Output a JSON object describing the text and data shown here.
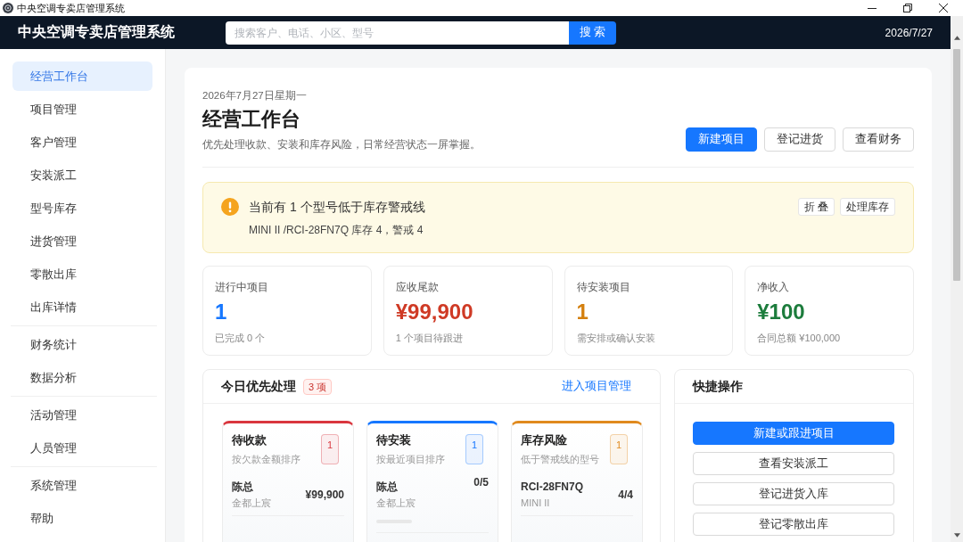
{
  "window": {
    "title": "中央空调专卖店管理系统"
  },
  "header": {
    "title": "中央空调专卖店管理系统",
    "search": {
      "placeholder": "搜索客户、电话、小区、型号",
      "button": "搜 索"
    },
    "date": "2026/7/27"
  },
  "sidebar": {
    "groups": [
      {
        "items": [
          {
            "label": "经营工作台",
            "selected": true
          },
          {
            "label": "项目管理",
            "selected": false
          },
          {
            "label": "客户管理",
            "selected": false
          },
          {
            "label": "安装派工",
            "selected": false
          },
          {
            "label": "型号库存",
            "selected": false
          },
          {
            "label": "进货管理",
            "selected": false
          },
          {
            "label": "零散出库",
            "selected": false
          },
          {
            "label": "出库详情",
            "selected": false
          }
        ]
      },
      {
        "items": [
          {
            "label": "财务统计",
            "selected": false
          },
          {
            "label": "数据分析",
            "selected": false
          }
        ]
      },
      {
        "items": [
          {
            "label": "活动管理",
            "selected": false
          },
          {
            "label": "人员管理",
            "selected": false
          }
        ]
      },
      {
        "items": [
          {
            "label": "系统管理",
            "selected": false
          },
          {
            "label": "帮助",
            "selected": false
          }
        ]
      }
    ]
  },
  "page": {
    "date": "2026年7月27日星期一",
    "title": "经营工作台",
    "subtitle": "优先处理收款、安装和库存风险，日常经营状态一屏掌握。",
    "actions": [
      {
        "label": "新建项目",
        "kind": "primary"
      },
      {
        "label": "登记进货",
        "kind": "default"
      },
      {
        "label": "查看财务",
        "kind": "default"
      }
    ]
  },
  "alert": {
    "title": "当前有 1 个型号低于库存警戒线",
    "detail": "MINI II /RCI-28FN7Q 库存 4，警戒 4",
    "actions": [
      "折 叠",
      "处理库存"
    ]
  },
  "stats": [
    {
      "label": "进行中项目",
      "value": "1",
      "note": "已完成 0 个",
      "color": "#1677ff"
    },
    {
      "label": "应收尾款",
      "value": "¥99,900",
      "note": "1 个项目待跟进",
      "color": "#cf3a25"
    },
    {
      "label": "待安装项目",
      "value": "1",
      "note": "需安排或确认安装",
      "color": "#d4800f"
    },
    {
      "label": "净收入",
      "value": "¥100",
      "note": "合同总额 ¥100,000",
      "color": "#1c7c3c"
    }
  ],
  "priority": {
    "title": "今日优先处理",
    "badge": "3 项",
    "link": "进入项目管理",
    "lanes": [
      {
        "title": "待收款",
        "subtitle": "按欠款金额排序",
        "count": "1",
        "color": "#d9363e",
        "items": [
          {
            "name": "陈总",
            "detail": "金都上宸",
            "value": "¥99,900"
          }
        ]
      },
      {
        "title": "待安装",
        "subtitle": "按最近项目排序",
        "count": "1",
        "color": "#1677ff",
        "items": [
          {
            "name": "陈总",
            "detail": "金都上宸",
            "value": "0/5",
            "level": 0
          }
        ]
      },
      {
        "title": "库存风险",
        "subtitle": "低于警戒线的型号",
        "count": "1",
        "color": "#e08a1e",
        "items": [
          {
            "name": "RCI-28FN7Q",
            "detail": "MINI II",
            "value": "4/4"
          }
        ]
      }
    ]
  },
  "quick_actions": {
    "title": "快捷操作",
    "buttons": [
      {
        "label": "新建或跟进项目",
        "kind": "primary"
      },
      {
        "label": "查看安装派工",
        "kind": "default"
      },
      {
        "label": "登记进货入库",
        "kind": "default"
      },
      {
        "label": "登记零散出库",
        "kind": "default"
      }
    ]
  }
}
